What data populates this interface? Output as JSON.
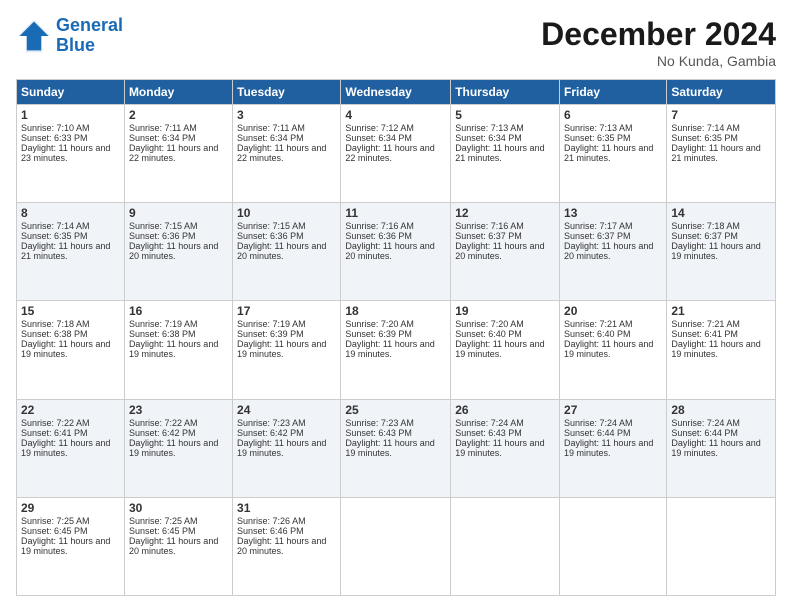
{
  "logo": {
    "line1": "General",
    "line2": "Blue"
  },
  "title": "December 2024",
  "location": "No Kunda, Gambia",
  "days_header": [
    "Sunday",
    "Monday",
    "Tuesday",
    "Wednesday",
    "Thursday",
    "Friday",
    "Saturday"
  ],
  "weeks": [
    [
      {
        "day": "1",
        "sunrise": "Sunrise: 7:10 AM",
        "sunset": "Sunset: 6:33 PM",
        "daylight": "Daylight: 11 hours and 23 minutes."
      },
      {
        "day": "2",
        "sunrise": "Sunrise: 7:11 AM",
        "sunset": "Sunset: 6:34 PM",
        "daylight": "Daylight: 11 hours and 22 minutes."
      },
      {
        "day": "3",
        "sunrise": "Sunrise: 7:11 AM",
        "sunset": "Sunset: 6:34 PM",
        "daylight": "Daylight: 11 hours and 22 minutes."
      },
      {
        "day": "4",
        "sunrise": "Sunrise: 7:12 AM",
        "sunset": "Sunset: 6:34 PM",
        "daylight": "Daylight: 11 hours and 22 minutes."
      },
      {
        "day": "5",
        "sunrise": "Sunrise: 7:13 AM",
        "sunset": "Sunset: 6:34 PM",
        "daylight": "Daylight: 11 hours and 21 minutes."
      },
      {
        "day": "6",
        "sunrise": "Sunrise: 7:13 AM",
        "sunset": "Sunset: 6:35 PM",
        "daylight": "Daylight: 11 hours and 21 minutes."
      },
      {
        "day": "7",
        "sunrise": "Sunrise: 7:14 AM",
        "sunset": "Sunset: 6:35 PM",
        "daylight": "Daylight: 11 hours and 21 minutes."
      }
    ],
    [
      {
        "day": "8",
        "sunrise": "Sunrise: 7:14 AM",
        "sunset": "Sunset: 6:35 PM",
        "daylight": "Daylight: 11 hours and 21 minutes."
      },
      {
        "day": "9",
        "sunrise": "Sunrise: 7:15 AM",
        "sunset": "Sunset: 6:36 PM",
        "daylight": "Daylight: 11 hours and 20 minutes."
      },
      {
        "day": "10",
        "sunrise": "Sunrise: 7:15 AM",
        "sunset": "Sunset: 6:36 PM",
        "daylight": "Daylight: 11 hours and 20 minutes."
      },
      {
        "day": "11",
        "sunrise": "Sunrise: 7:16 AM",
        "sunset": "Sunset: 6:36 PM",
        "daylight": "Daylight: 11 hours and 20 minutes."
      },
      {
        "day": "12",
        "sunrise": "Sunrise: 7:16 AM",
        "sunset": "Sunset: 6:37 PM",
        "daylight": "Daylight: 11 hours and 20 minutes."
      },
      {
        "day": "13",
        "sunrise": "Sunrise: 7:17 AM",
        "sunset": "Sunset: 6:37 PM",
        "daylight": "Daylight: 11 hours and 20 minutes."
      },
      {
        "day": "14",
        "sunrise": "Sunrise: 7:18 AM",
        "sunset": "Sunset: 6:37 PM",
        "daylight": "Daylight: 11 hours and 19 minutes."
      }
    ],
    [
      {
        "day": "15",
        "sunrise": "Sunrise: 7:18 AM",
        "sunset": "Sunset: 6:38 PM",
        "daylight": "Daylight: 11 hours and 19 minutes."
      },
      {
        "day": "16",
        "sunrise": "Sunrise: 7:19 AM",
        "sunset": "Sunset: 6:38 PM",
        "daylight": "Daylight: 11 hours and 19 minutes."
      },
      {
        "day": "17",
        "sunrise": "Sunrise: 7:19 AM",
        "sunset": "Sunset: 6:39 PM",
        "daylight": "Daylight: 11 hours and 19 minutes."
      },
      {
        "day": "18",
        "sunrise": "Sunrise: 7:20 AM",
        "sunset": "Sunset: 6:39 PM",
        "daylight": "Daylight: 11 hours and 19 minutes."
      },
      {
        "day": "19",
        "sunrise": "Sunrise: 7:20 AM",
        "sunset": "Sunset: 6:40 PM",
        "daylight": "Daylight: 11 hours and 19 minutes."
      },
      {
        "day": "20",
        "sunrise": "Sunrise: 7:21 AM",
        "sunset": "Sunset: 6:40 PM",
        "daylight": "Daylight: 11 hours and 19 minutes."
      },
      {
        "day": "21",
        "sunrise": "Sunrise: 7:21 AM",
        "sunset": "Sunset: 6:41 PM",
        "daylight": "Daylight: 11 hours and 19 minutes."
      }
    ],
    [
      {
        "day": "22",
        "sunrise": "Sunrise: 7:22 AM",
        "sunset": "Sunset: 6:41 PM",
        "daylight": "Daylight: 11 hours and 19 minutes."
      },
      {
        "day": "23",
        "sunrise": "Sunrise: 7:22 AM",
        "sunset": "Sunset: 6:42 PM",
        "daylight": "Daylight: 11 hours and 19 minutes."
      },
      {
        "day": "24",
        "sunrise": "Sunrise: 7:23 AM",
        "sunset": "Sunset: 6:42 PM",
        "daylight": "Daylight: 11 hours and 19 minutes."
      },
      {
        "day": "25",
        "sunrise": "Sunrise: 7:23 AM",
        "sunset": "Sunset: 6:43 PM",
        "daylight": "Daylight: 11 hours and 19 minutes."
      },
      {
        "day": "26",
        "sunrise": "Sunrise: 7:24 AM",
        "sunset": "Sunset: 6:43 PM",
        "daylight": "Daylight: 11 hours and 19 minutes."
      },
      {
        "day": "27",
        "sunrise": "Sunrise: 7:24 AM",
        "sunset": "Sunset: 6:44 PM",
        "daylight": "Daylight: 11 hours and 19 minutes."
      },
      {
        "day": "28",
        "sunrise": "Sunrise: 7:24 AM",
        "sunset": "Sunset: 6:44 PM",
        "daylight": "Daylight: 11 hours and 19 minutes."
      }
    ],
    [
      {
        "day": "29",
        "sunrise": "Sunrise: 7:25 AM",
        "sunset": "Sunset: 6:45 PM",
        "daylight": "Daylight: 11 hours and 19 minutes."
      },
      {
        "day": "30",
        "sunrise": "Sunrise: 7:25 AM",
        "sunset": "Sunset: 6:45 PM",
        "daylight": "Daylight: 11 hours and 20 minutes."
      },
      {
        "day": "31",
        "sunrise": "Sunrise: 7:26 AM",
        "sunset": "Sunset: 6:46 PM",
        "daylight": "Daylight: 11 hours and 20 minutes."
      },
      null,
      null,
      null,
      null
    ]
  ]
}
